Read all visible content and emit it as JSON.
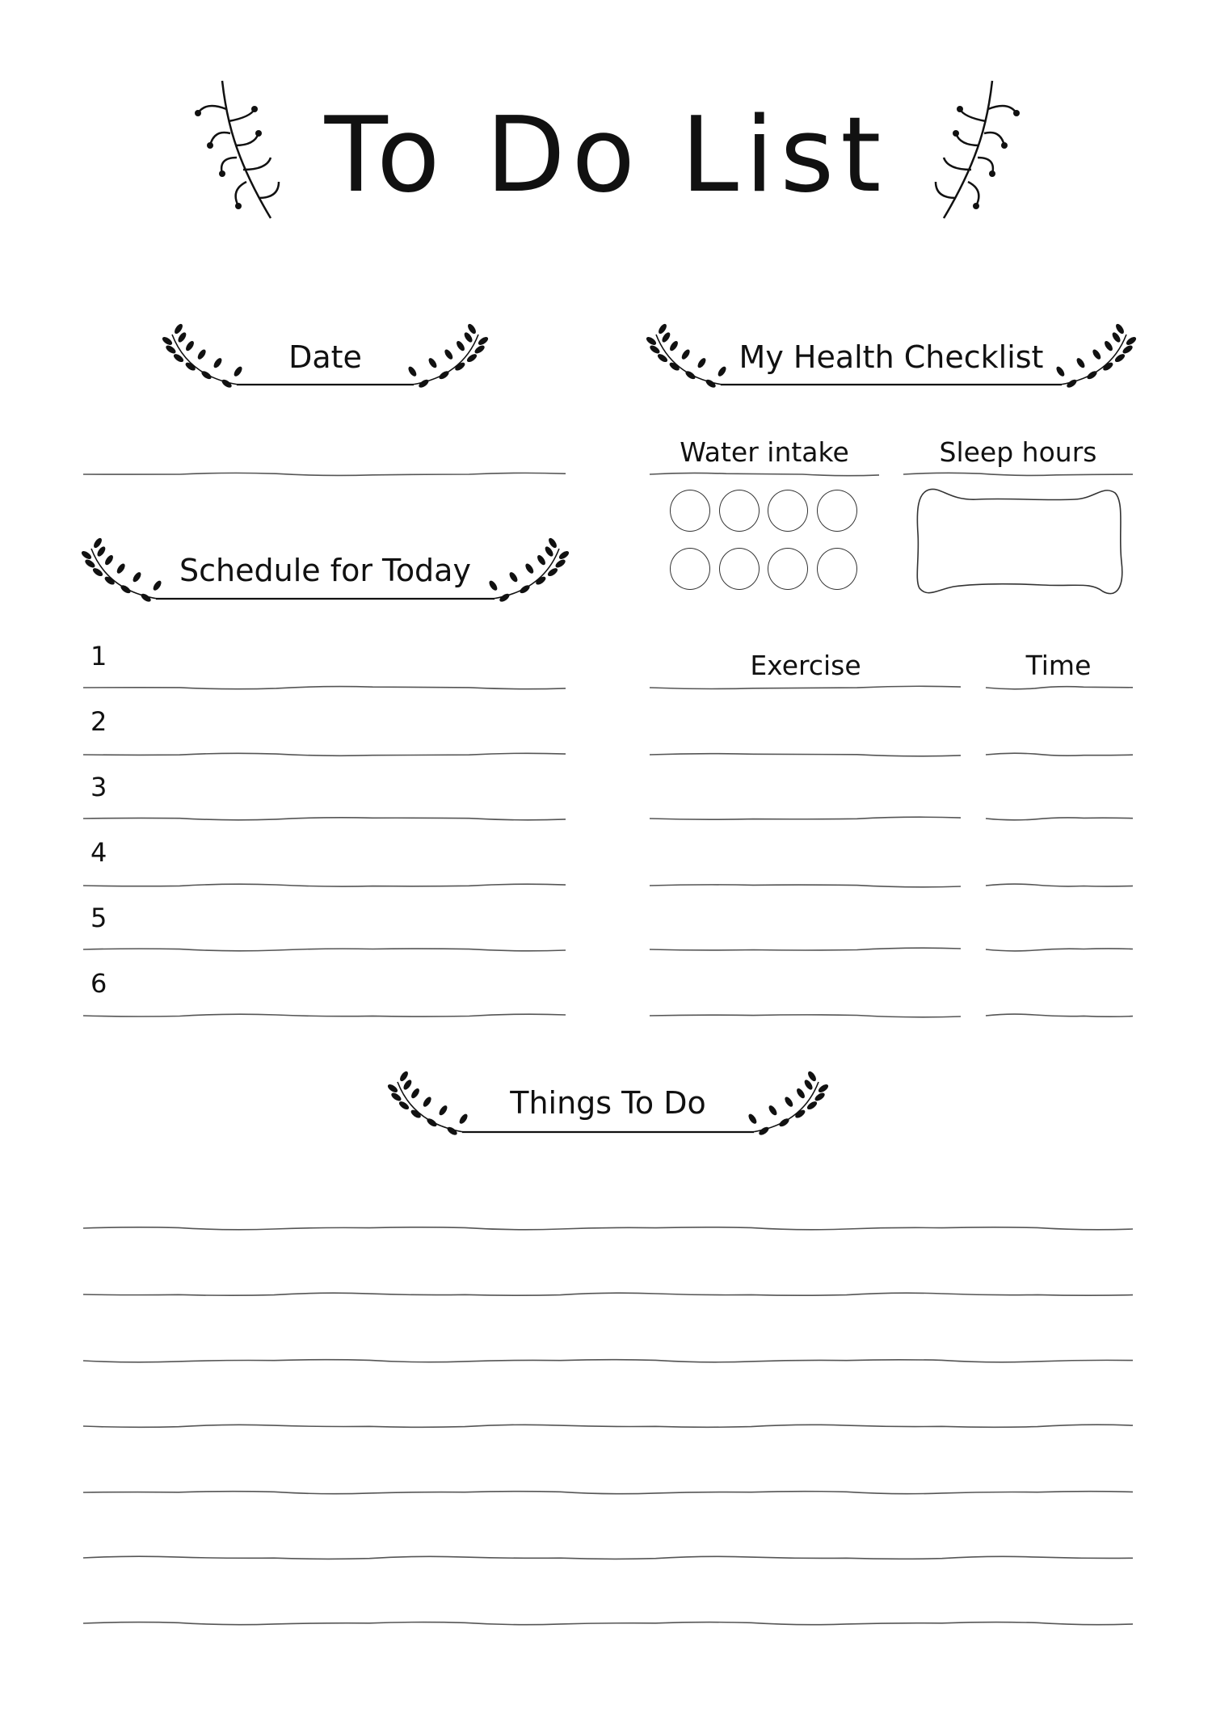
{
  "title": "To Do List",
  "sections": {
    "date": {
      "heading": "Date"
    },
    "health": {
      "heading": "My Health Checklist",
      "water_label": "Water intake",
      "water_glasses": 8,
      "sleep_label": "Sleep hours",
      "exercise_label": "Exercise",
      "time_label": "Time"
    },
    "schedule": {
      "heading": "Schedule for Today",
      "numbers": [
        "1",
        "2",
        "3",
        "4",
        "5",
        "6"
      ]
    },
    "things": {
      "heading": "Things To Do"
    }
  }
}
